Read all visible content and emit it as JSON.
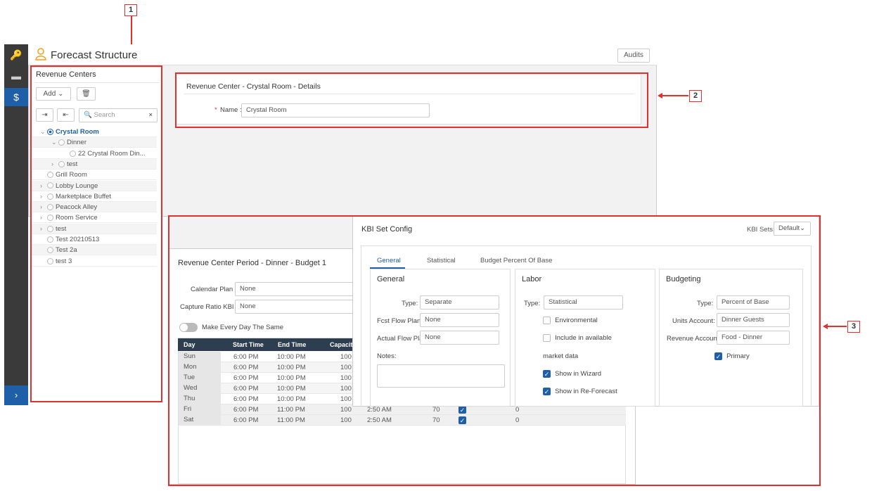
{
  "callouts": [
    "1",
    "2",
    "3"
  ],
  "header": {
    "title": "Forecast Structure",
    "audits_label": "Audits"
  },
  "sidebar": {
    "title": "Revenue Centers",
    "add_label": "Add",
    "search_placeholder": "Search",
    "tree": [
      {
        "label": "Crystal Room",
        "level": 0,
        "expand": "⌄",
        "selected": true
      },
      {
        "label": "Dinner",
        "level": 1,
        "expand": "⌄"
      },
      {
        "label": "22 Crystal Room Din...",
        "level": 2,
        "expand": ""
      },
      {
        "label": "test",
        "level": 1,
        "expand": "›"
      },
      {
        "label": "Grill Room",
        "level": 0,
        "expand": ""
      },
      {
        "label": "Lobby Lounge",
        "level": 0,
        "expand": "›"
      },
      {
        "label": "Marketplace Buffet",
        "level": 0,
        "expand": "›"
      },
      {
        "label": "Peacock Alley",
        "level": 0,
        "expand": "›"
      },
      {
        "label": "Room Service",
        "level": 0,
        "expand": "›"
      },
      {
        "label": "test",
        "level": 0,
        "expand": "›"
      },
      {
        "label": "Test 20210513",
        "level": 0,
        "expand": ""
      },
      {
        "label": "Test 2a",
        "level": 0,
        "expand": ""
      },
      {
        "label": "test 3",
        "level": 0,
        "expand": ""
      }
    ]
  },
  "details": {
    "title": "Revenue Center - Crystal Room - Details",
    "required_mark": "*",
    "name_label": "Name :",
    "name_value": "Crystal Room"
  },
  "period": {
    "title": "Revenue Center Period - Dinner - Budget 1",
    "calendar_plan_label": "Calendar Plan :",
    "calendar_plan_value": "None",
    "capture_ratio_label": "Capture Ratio KBI :",
    "capture_ratio_value": "None",
    "toggle_label": "Make Every Day The Same",
    "columns": [
      "Day",
      "Start Time",
      "End Time",
      "Capacity"
    ],
    "rows": [
      {
        "day": "Sun",
        "start": "6:00 PM",
        "end": "10:00 PM",
        "cap": "100"
      },
      {
        "day": "Mon",
        "start": "6:00 PM",
        "end": "10:00 PM",
        "cap": "100"
      },
      {
        "day": "Tue",
        "start": "6:00 PM",
        "end": "10:00 PM",
        "cap": "100"
      },
      {
        "day": "Wed",
        "start": "6:00 PM",
        "end": "10:00 PM",
        "cap": "100"
      },
      {
        "day": "Thu",
        "start": "6:00 PM",
        "end": "10:00 PM",
        "cap": "100"
      },
      {
        "day": "Fri",
        "start": "6:00 PM",
        "end": "11:00 PM",
        "cap": "100",
        "extra_time": "2:50 AM",
        "extra_num": "70",
        "extra_zero": "0"
      },
      {
        "day": "Sat",
        "start": "6:00 PM",
        "end": "11:00 PM",
        "cap": "100",
        "extra_time": "2:50 AM",
        "extra_num": "70",
        "extra_zero": "0"
      }
    ]
  },
  "kbi": {
    "title": "KBI Set Config",
    "sets_label": "KBI Sets:",
    "sets_value": "Default",
    "tabs": [
      "General",
      "Statistical",
      "Budget Percent Of Base"
    ],
    "general": {
      "heading": "General",
      "type_label": "Type:",
      "type_value": "Separate",
      "fcst_label": "Fcst Flow Plan:",
      "fcst_value": "None",
      "actual_label": "Actual Flow Plan",
      "actual_value": "None",
      "notes_label": "Notes:"
    },
    "labor": {
      "heading": "Labor",
      "type_label": "Type:",
      "type_value": "Statistical",
      "environmental": "Environmental",
      "include": "Include in available",
      "market": "market data",
      "wizard": "Show in Wizard",
      "reforecast": "Show in Re-Forecast"
    },
    "budgeting": {
      "heading": "Budgeting",
      "type_label": "Type:",
      "type_value": "Percent of Base",
      "units_label": "Units Account:",
      "units_value": "Dinner Guests",
      "revenue_label": "Revenue Account",
      "revenue_value": "Food - Dinner",
      "primary": "Primary"
    }
  }
}
